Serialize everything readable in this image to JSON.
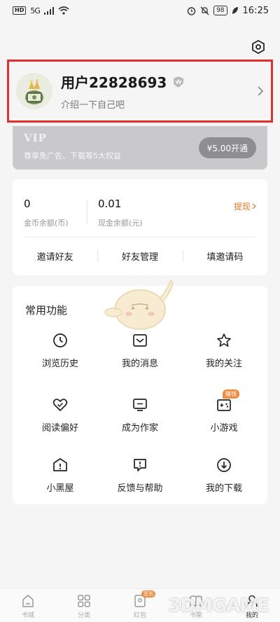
{
  "status_bar": {
    "network_badge": "HD",
    "signal": "5G",
    "battery": "98",
    "time": "16:25"
  },
  "profile": {
    "username": "用户22828693",
    "bio": "介绍一下自己吧"
  },
  "vip": {
    "title": "VIP",
    "description": "尊享免广告、下载等5大权益",
    "button": "¥5.00开通"
  },
  "wallet": {
    "coins": {
      "value": "0",
      "label": "金币余额(币)"
    },
    "cash": {
      "value": "0.01",
      "label": "现金余额(元)"
    },
    "withdraw": "提现",
    "actions": [
      "邀请好友",
      "好友管理",
      "填邀请码"
    ]
  },
  "functions": {
    "title": "常用功能",
    "items": [
      {
        "label": "浏览历史",
        "icon": "clock-icon"
      },
      {
        "label": "我的消息",
        "icon": "inbox-icon"
      },
      {
        "label": "我的关注",
        "icon": "star-icon"
      },
      {
        "label": "阅读偏好",
        "icon": "heart-icon"
      },
      {
        "label": "成为作家",
        "icon": "monitor-icon"
      },
      {
        "label": "小游戏",
        "icon": "gamepad-icon",
        "badge": "赚钱"
      },
      {
        "label": "小黑屋",
        "icon": "house-icon"
      },
      {
        "label": "反馈与帮助",
        "icon": "feedback-icon"
      },
      {
        "label": "我的下载",
        "icon": "download-icon"
      }
    ]
  },
  "bottom_nav": {
    "items": [
      {
        "label": "书城"
      },
      {
        "label": "分类"
      },
      {
        "label": "红包",
        "badge": "签到"
      },
      {
        "label": "书架"
      },
      {
        "label": "我的"
      }
    ]
  },
  "watermark": "3DMGAME",
  "colors": {
    "highlight_border": "#e03131",
    "accent_orange": "#e07b2a",
    "vip_bg": "#c9c9cc"
  }
}
